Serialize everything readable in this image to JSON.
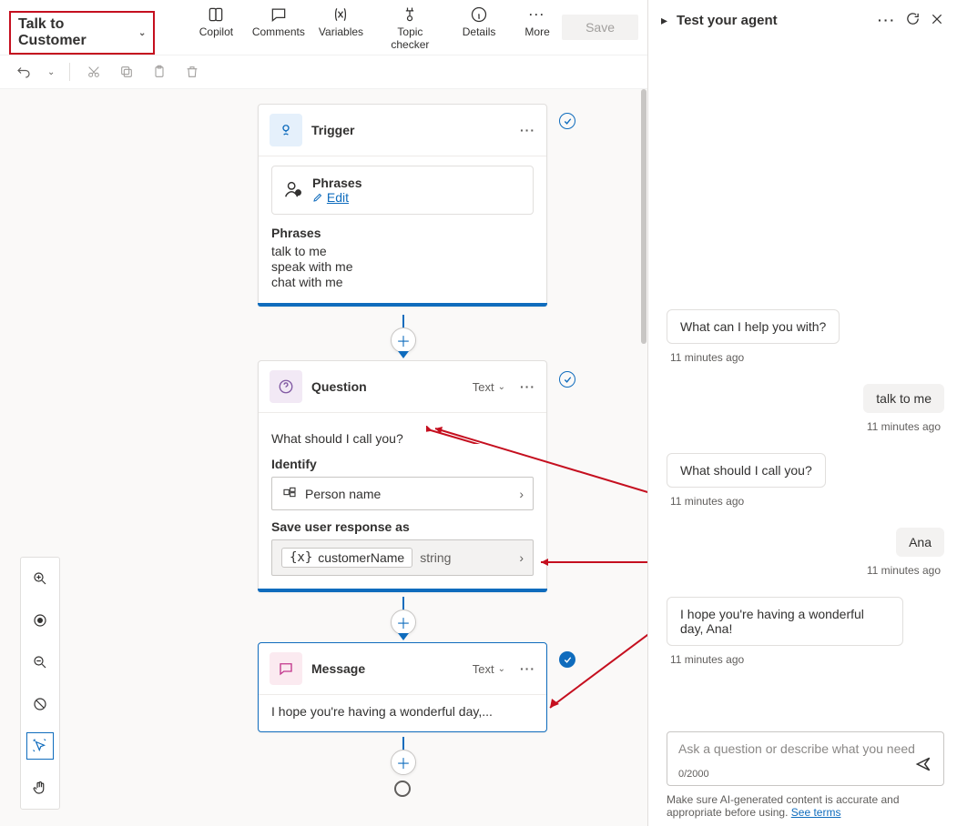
{
  "topic_name": "Talk to Customer",
  "toolbar": {
    "copilot": "Copilot",
    "comments": "Comments",
    "variables": "Variables",
    "topic_checker": "Topic checker",
    "details": "Details",
    "more": "More",
    "save": "Save"
  },
  "trigger": {
    "title": "Trigger",
    "phrases_label": "Phrases",
    "edit": "Edit",
    "phrases_header": "Phrases",
    "phrases": [
      "talk to me",
      "speak with me",
      "chat with me"
    ]
  },
  "question": {
    "title": "Question",
    "type": "Text",
    "prompt": "What should I call you?",
    "identify_label": "Identify",
    "identify_value": "Person name",
    "save_as_label": "Save user response as",
    "var_name": "customerName",
    "var_type": "string"
  },
  "message": {
    "title": "Message",
    "type": "Text",
    "text": "I hope you're having a wonderful day,..."
  },
  "test_panel": {
    "title": "Test your agent",
    "messages": [
      {
        "role": "bot",
        "text": "What can I help you with?",
        "ts": "11 minutes ago"
      },
      {
        "role": "user",
        "text": "talk to me",
        "ts": "11 minutes ago"
      },
      {
        "role": "bot",
        "text": "What should I call you?",
        "ts": "11 minutes ago"
      },
      {
        "role": "user",
        "text": "Ana",
        "ts": "11 minutes ago"
      },
      {
        "role": "bot",
        "text": "I hope you're having a wonderful day, Ana!",
        "ts": "11 minutes ago"
      }
    ],
    "placeholder": "Ask a question or describe what you need",
    "counter": "0/2000",
    "disclaimer_pre": "Make sure AI-generated content is accurate and appropriate before using. ",
    "see_terms": "See terms"
  }
}
